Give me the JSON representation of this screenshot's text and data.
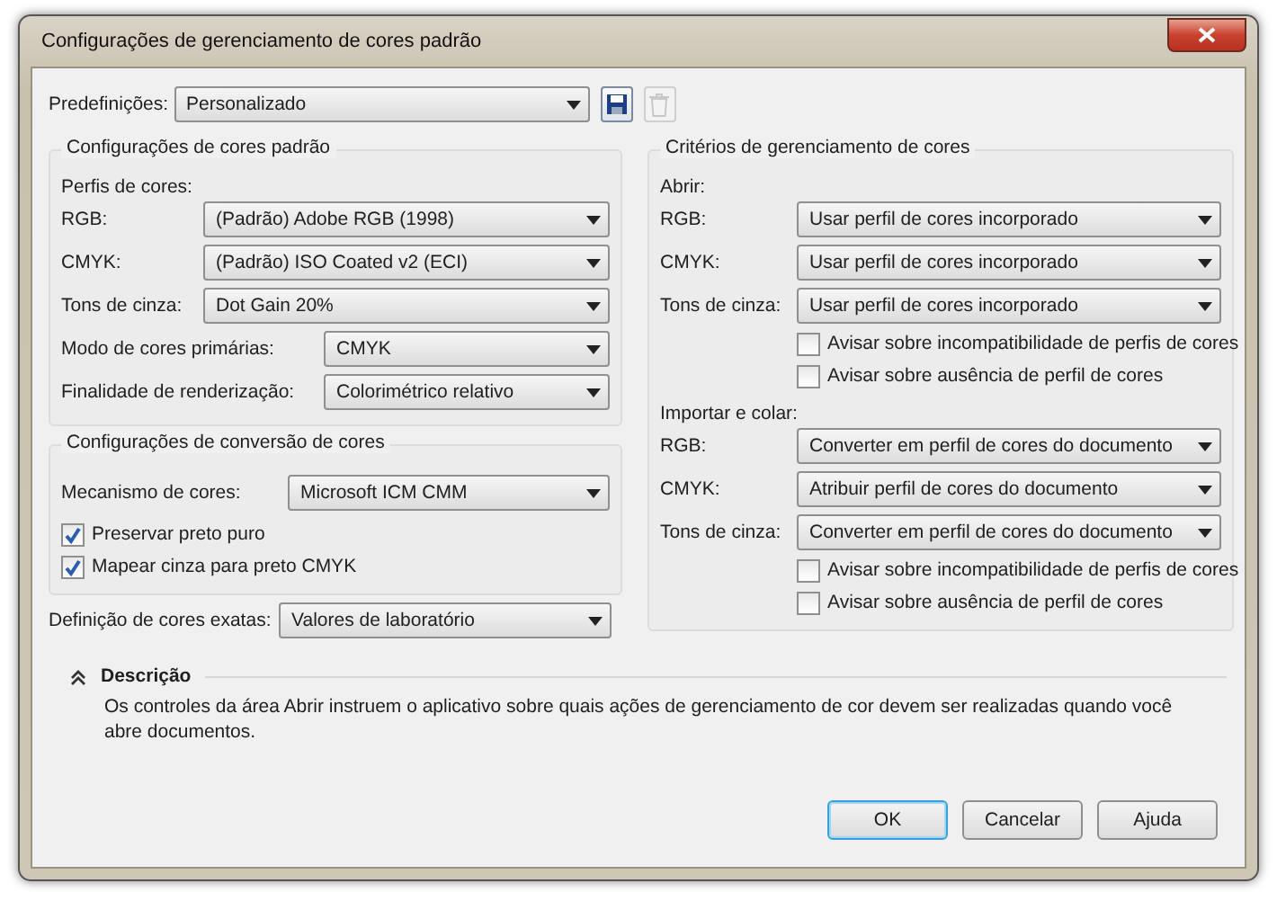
{
  "window": {
    "title": "Configurações de gerenciamento de cores padrão"
  },
  "presets": {
    "label": "Predefinições:",
    "value": "Personalizado",
    "delete_disabled": true
  },
  "default_settings": {
    "title": "Configurações de cores padrão",
    "subtitle": "Perfis de cores:",
    "profiles": [
      {
        "label": "RGB:",
        "value": "(Padrão) Adobe RGB (1998)"
      },
      {
        "label": "CMYK:",
        "value": "(Padrão) ISO Coated v2 (ECI)"
      },
      {
        "label": "Tons de cinza:",
        "value": "Dot Gain 20%"
      }
    ],
    "options": [
      {
        "label": "Modo de cores primárias:",
        "value": "CMYK"
      },
      {
        "label": "Finalidade de renderização:",
        "value": "Colorimétrico relativo"
      }
    ]
  },
  "conversion_settings": {
    "title": "Configurações de conversão de cores",
    "engine": {
      "label": "Mecanismo de cores:",
      "value": "Microsoft ICM CMM"
    },
    "checkboxes": [
      {
        "label": "Preservar preto puro",
        "checked": true
      },
      {
        "label": "Mapear cinza para preto CMYK",
        "checked": true
      }
    ]
  },
  "spot_colors": {
    "label": "Definição de cores exatas:",
    "value": "Valores de laboratório"
  },
  "policies": {
    "title": "Critérios de gerenciamento de cores",
    "sections": [
      {
        "heading": "Abrir:",
        "rows": [
          {
            "label": "RGB:",
            "value": "Usar perfil de cores incorporado"
          },
          {
            "label": "CMYK:",
            "value": "Usar perfil de cores incorporado"
          },
          {
            "label": "Tons de cinza:",
            "value": "Usar perfil de cores incorporado"
          }
        ],
        "checkboxes": [
          {
            "label": "Avisar sobre incompatibilidade de perfis de cores",
            "checked": false
          },
          {
            "label": "Avisar sobre ausência de perfil de cores",
            "checked": false
          }
        ]
      },
      {
        "heading": "Importar e colar:",
        "rows": [
          {
            "label": "RGB:",
            "value": "Converter em perfil de cores do documento"
          },
          {
            "label": "CMYK:",
            "value": "Atribuir perfil de cores do documento"
          },
          {
            "label": "Tons de cinza:",
            "value": "Converter em perfil de cores do documento"
          }
        ],
        "checkboxes": [
          {
            "label": "Avisar sobre incompatibilidade de perfis de cores",
            "checked": false
          },
          {
            "label": "Avisar sobre ausência de perfil de cores",
            "checked": false
          }
        ]
      }
    ]
  },
  "description": {
    "title": "Descrição",
    "expanded": true,
    "text": "Os controles da área Abrir instruem o aplicativo sobre quais ações de gerenciamento de cor devem ser realizadas quando você abre documentos."
  },
  "buttons": [
    {
      "label": "OK",
      "default": true
    },
    {
      "label": "Cancelar",
      "default": false
    },
    {
      "label": "Ajuda",
      "default": false
    }
  ]
}
